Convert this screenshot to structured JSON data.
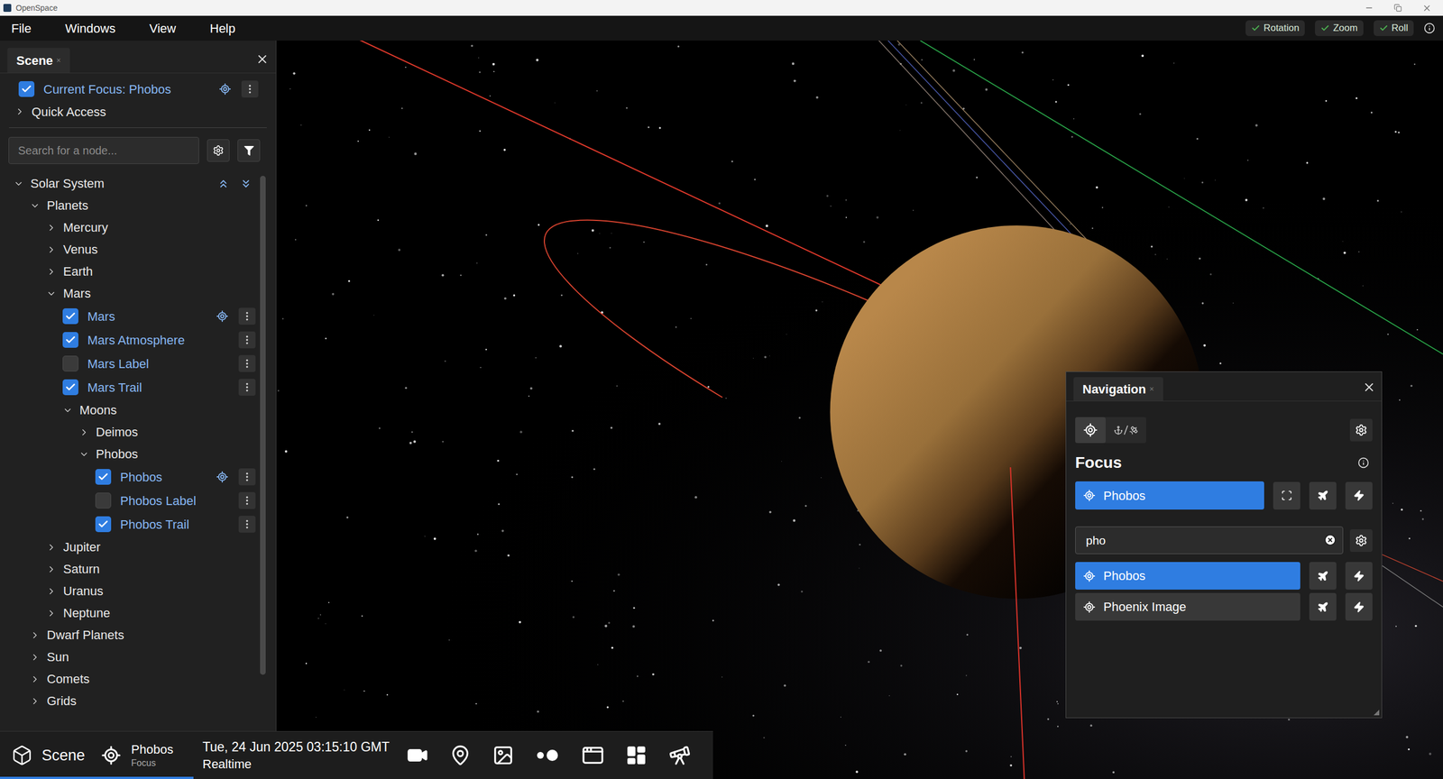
{
  "window": {
    "title": "OpenSpace"
  },
  "menu": [
    "File",
    "Windows",
    "View",
    "Help"
  ],
  "toggles": [
    {
      "label": "Rotation",
      "checked": true
    },
    {
      "label": "Zoom",
      "checked": true
    },
    {
      "label": "Roll",
      "checked": true
    }
  ],
  "scene_panel": {
    "tab": "Scene",
    "tab_close": "×",
    "current_focus": {
      "label": "Current Focus: Phobos",
      "checked": true
    },
    "quick_access": {
      "label": "Quick Access",
      "expanded": false
    },
    "search": {
      "placeholder": "Search for a node..."
    },
    "tree": [
      {
        "label": "Solar System",
        "depth": 0,
        "kind": "root",
        "expanded": true
      },
      {
        "label": "Planets",
        "depth": 1,
        "kind": "group",
        "expanded": true
      },
      {
        "label": "Mercury",
        "depth": 2,
        "kind": "group",
        "expanded": false
      },
      {
        "label": "Venus",
        "depth": 2,
        "kind": "group",
        "expanded": false
      },
      {
        "label": "Earth",
        "depth": 2,
        "kind": "group",
        "expanded": false
      },
      {
        "label": "Mars",
        "depth": 2,
        "kind": "group",
        "expanded": true
      },
      {
        "label": "Mars",
        "depth": 3,
        "kind": "node",
        "checked": true,
        "focusable": true
      },
      {
        "label": "Mars Atmosphere",
        "depth": 3,
        "kind": "node",
        "checked": true,
        "focusable": false
      },
      {
        "label": "Mars Label",
        "depth": 3,
        "kind": "node",
        "checked": false,
        "focusable": false
      },
      {
        "label": "Mars Trail",
        "depth": 3,
        "kind": "node",
        "checked": true,
        "focusable": false
      },
      {
        "label": "Moons",
        "depth": 3,
        "kind": "group",
        "expanded": true
      },
      {
        "label": "Deimos",
        "depth": 4,
        "kind": "group",
        "expanded": false
      },
      {
        "label": "Phobos",
        "depth": 4,
        "kind": "group",
        "expanded": true
      },
      {
        "label": "Phobos",
        "depth": 5,
        "kind": "node",
        "checked": true,
        "focusable": true
      },
      {
        "label": "Phobos Label",
        "depth": 5,
        "kind": "node",
        "checked": false,
        "focusable": false
      },
      {
        "label": "Phobos Trail",
        "depth": 5,
        "kind": "node",
        "checked": true,
        "focusable": false
      },
      {
        "label": "Jupiter",
        "depth": 2,
        "kind": "group",
        "expanded": false
      },
      {
        "label": "Saturn",
        "depth": 2,
        "kind": "group",
        "expanded": false
      },
      {
        "label": "Uranus",
        "depth": 2,
        "kind": "group",
        "expanded": false
      },
      {
        "label": "Neptune",
        "depth": 2,
        "kind": "group",
        "expanded": false
      },
      {
        "label": "Dwarf Planets",
        "depth": 1,
        "kind": "group",
        "expanded": false
      },
      {
        "label": "Sun",
        "depth": 1,
        "kind": "group",
        "expanded": false
      },
      {
        "label": "Comets",
        "depth": 1,
        "kind": "group",
        "expanded": false
      },
      {
        "label": "Grids",
        "depth": 1,
        "kind": "group",
        "expanded": false
      }
    ]
  },
  "navigation": {
    "tab": "Navigation",
    "tab_close": "×",
    "modes": [
      {
        "kind": "focus",
        "selected": true
      },
      {
        "kind": "anchor-aim",
        "selected": false
      }
    ],
    "heading": "Focus",
    "focus": {
      "label": "Phobos"
    },
    "search": {
      "value": "pho"
    },
    "results": [
      {
        "label": "Phobos",
        "selected": true
      },
      {
        "label": "Phoenix Image",
        "selected": false
      }
    ]
  },
  "bottom_bar": {
    "scene": {
      "label": "Scene",
      "selected": true
    },
    "focus": {
      "label": "Phobos",
      "sub": "Focus"
    },
    "time": {
      "date": "Tue, 24 Jun 2025 03:15:10 GMT",
      "mode": "Realtime"
    }
  }
}
